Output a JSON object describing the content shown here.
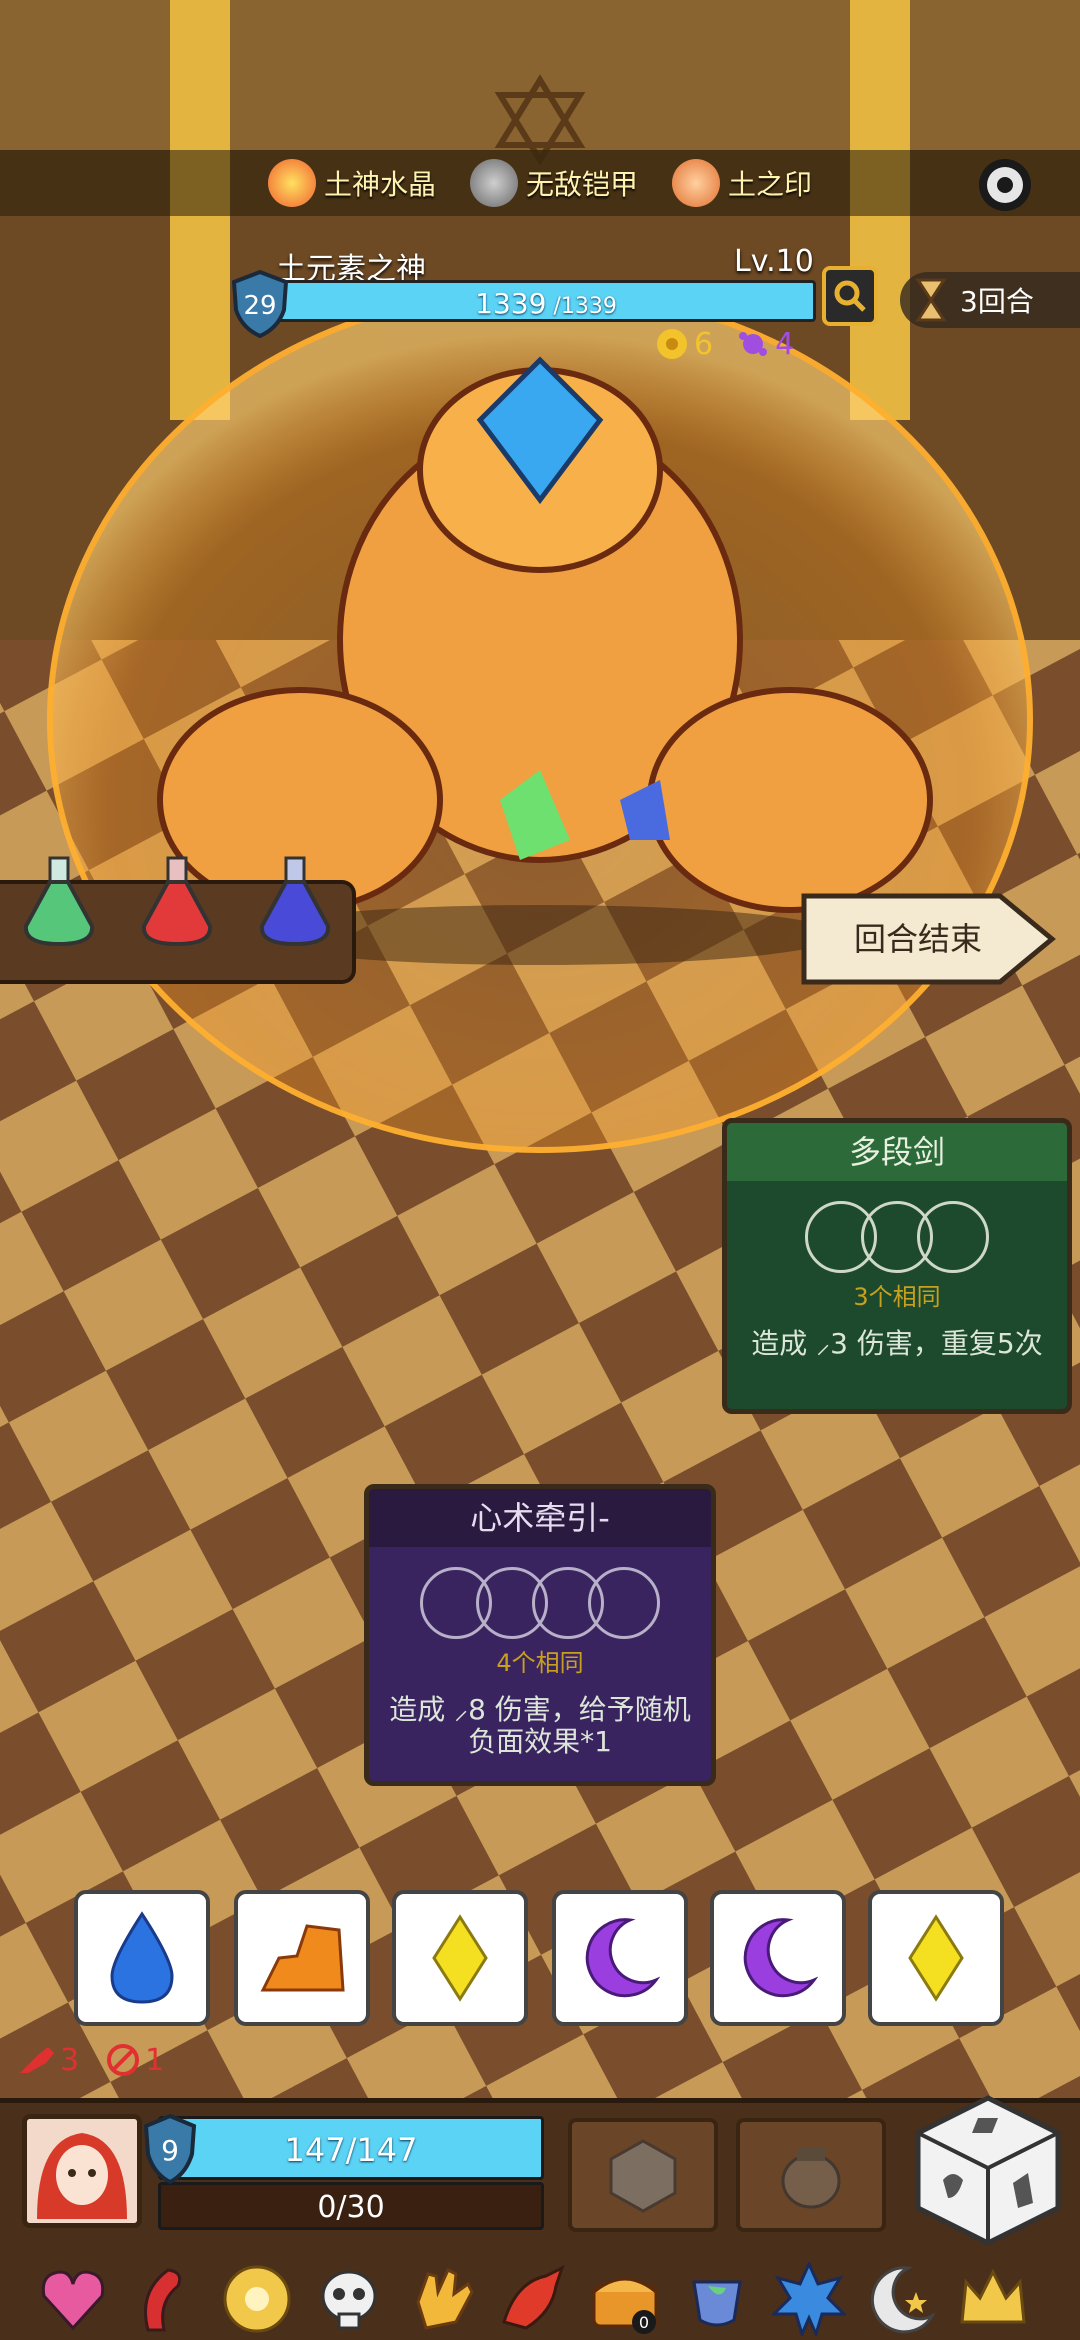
{
  "relics_top": [
    {
      "label": "土神水晶",
      "icon": "earth-crystal-icon"
    },
    {
      "label": "无敌铠甲",
      "icon": "invincible-armor-icon"
    },
    {
      "label": "土之印",
      "icon": "earth-seal-icon"
    }
  ],
  "boss": {
    "name": "土元素之神",
    "level": "Lv.10",
    "shield": "29",
    "hp_current": "1339",
    "hp_max": " /1339",
    "hp_fraction": 1.0,
    "status": [
      {
        "icon": "weak-status-icon",
        "value": "6",
        "color": "#f2c32b"
      },
      {
        "icon": "poison-status-icon",
        "value": "4",
        "color": "#a04ee0"
      }
    ]
  },
  "round": {
    "label": "3回合"
  },
  "potions": [
    {
      "icon": "green-potion-icon",
      "color": "#56c77a"
    },
    {
      "icon": "red-potion-icon",
      "color": "#e23a3a"
    },
    {
      "icon": "blue-potion-icon",
      "color": "#4a4ad8"
    }
  ],
  "end_turn": {
    "label": "回合结束"
  },
  "cards": {
    "green": {
      "title": "多段剑",
      "requirement": "3个相同",
      "description": "造成 ⸝3 伤害，重复5次",
      "slots": 3
    },
    "purple": {
      "title": "心术牵引-",
      "requirement": "4个相同",
      "description": "造成 ⸝8 伤害，给予随机负面效果*1",
      "slots": 4
    }
  },
  "dice": [
    {
      "face": "water-drop",
      "color": "#2a73e0"
    },
    {
      "face": "rock",
      "color": "#f08a1c"
    },
    {
      "face": "diamond",
      "color": "#f4e020"
    },
    {
      "face": "moon",
      "color": "#9a3ee0"
    },
    {
      "face": "moon",
      "color": "#9a3ee0"
    },
    {
      "face": "diamond",
      "color": "#f4e020"
    }
  ],
  "counters": {
    "attack": "3",
    "blocked": "1"
  },
  "player": {
    "shield": "9",
    "hp": "147/147",
    "hp_fraction": 1.0,
    "energy": "0/30"
  },
  "relic_strip": [
    {
      "icon": "heart-amulet-icon"
    },
    {
      "icon": "red-horn-icon"
    },
    {
      "icon": "golden-wheel-icon"
    },
    {
      "icon": "skull-icon"
    },
    {
      "icon": "golden-glove-icon"
    },
    {
      "icon": "red-dragon-icon"
    },
    {
      "icon": "treasure-chest-icon",
      "badge": "0"
    },
    {
      "icon": "leaf-cup-icon"
    },
    {
      "icon": "blue-spike-icon"
    },
    {
      "icon": "moon-star-icon"
    },
    {
      "icon": "golden-crown-icon"
    }
  ]
}
